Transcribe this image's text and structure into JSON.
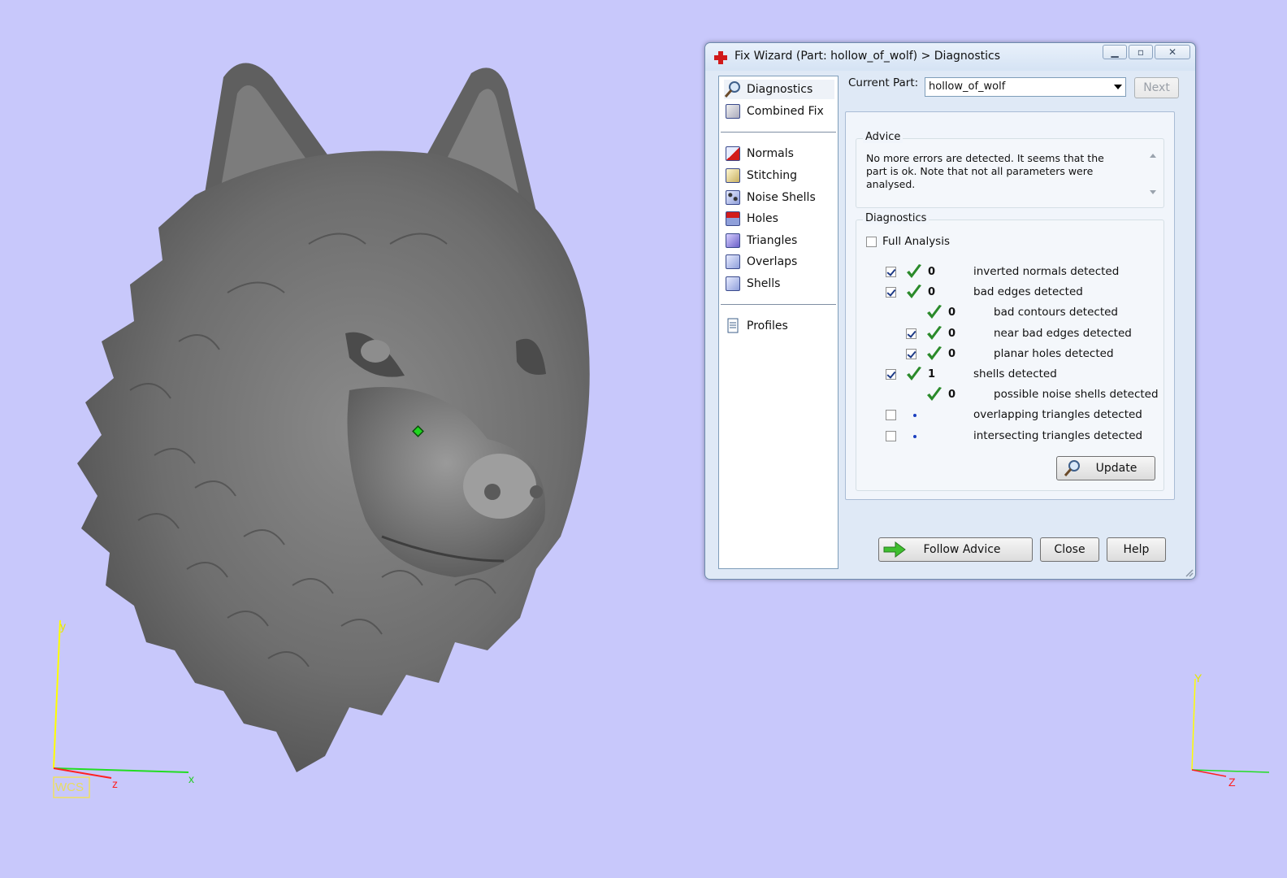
{
  "viewport": {
    "background": "#c8c8fb",
    "wcs_label": "WCS",
    "axes_left": {
      "y": "y",
      "z": "z",
      "x": "x"
    },
    "axes_right": {
      "y": "Y",
      "z": "Z"
    },
    "model_name": "wolf head"
  },
  "dialog": {
    "title": "Fix Wizard (Part: hollow_of_wolf) > Diagnostics",
    "nav_items": [
      {
        "label": "Diagnostics",
        "icon": "magnifier-icon"
      },
      {
        "label": "Combined Fix",
        "icon": "combined-fix-icon"
      },
      {
        "label": "Normals",
        "icon": "normals-cube-icon"
      },
      {
        "label": "Stitching",
        "icon": "stitching-cube-icon"
      },
      {
        "label": "Noise Shells",
        "icon": "noise-shells-icon"
      },
      {
        "label": "Holes",
        "icon": "holes-cube-icon"
      },
      {
        "label": "Triangles",
        "icon": "triangles-cube-icon"
      },
      {
        "label": "Overlaps",
        "icon": "overlaps-cube-icon"
      },
      {
        "label": "Shells",
        "icon": "shells-cube-icon"
      },
      {
        "label": "Profiles",
        "icon": "profile-document-icon"
      }
    ],
    "current_part_label": "Current Part:",
    "current_part_value": "hollow_of_wolf",
    "next_label": "Next",
    "advice_title": "Advice",
    "advice_text": "No more errors are detected. It seems that the part is ok. Note that not all parameters were analysed.",
    "diagnostics_title": "Diagnostics",
    "full_analysis_label": "Full Analysis",
    "full_analysis_checked": false,
    "rows": [
      {
        "checkbox": true,
        "checked": true,
        "status": "ok",
        "count": "0",
        "label": "inverted normals detected",
        "indent": 0
      },
      {
        "checkbox": true,
        "checked": true,
        "status": "ok",
        "count": "0",
        "label": "bad edges detected",
        "indent": 0
      },
      {
        "checkbox": false,
        "checked": false,
        "status": "ok",
        "count": "0",
        "label": "bad contours detected",
        "indent": 1
      },
      {
        "checkbox": true,
        "checked": true,
        "status": "ok",
        "count": "0",
        "label": "near bad edges detected",
        "indent": 1
      },
      {
        "checkbox": true,
        "checked": true,
        "status": "ok",
        "count": "0",
        "label": "planar holes detected",
        "indent": 1
      },
      {
        "checkbox": true,
        "checked": true,
        "status": "ok",
        "count": "1",
        "label": "shells detected",
        "indent": 0
      },
      {
        "checkbox": false,
        "checked": false,
        "status": "ok",
        "count": "0",
        "label": "possible noise shells detected",
        "indent": 1
      },
      {
        "checkbox": true,
        "checked": false,
        "status": "pending",
        "count": "",
        "label": "overlapping triangles detected",
        "indent": 0
      },
      {
        "checkbox": true,
        "checked": false,
        "status": "pending",
        "count": "",
        "label": "intersecting triangles detected",
        "indent": 0
      }
    ],
    "update_label": "Update",
    "follow_advice_label": "Follow Advice",
    "close_label": "Close",
    "help_label": "Help",
    "colors": {
      "tick": "#2a8a2a",
      "title_icon": "#d11a1a",
      "arrow": "#3fbf2f"
    }
  }
}
